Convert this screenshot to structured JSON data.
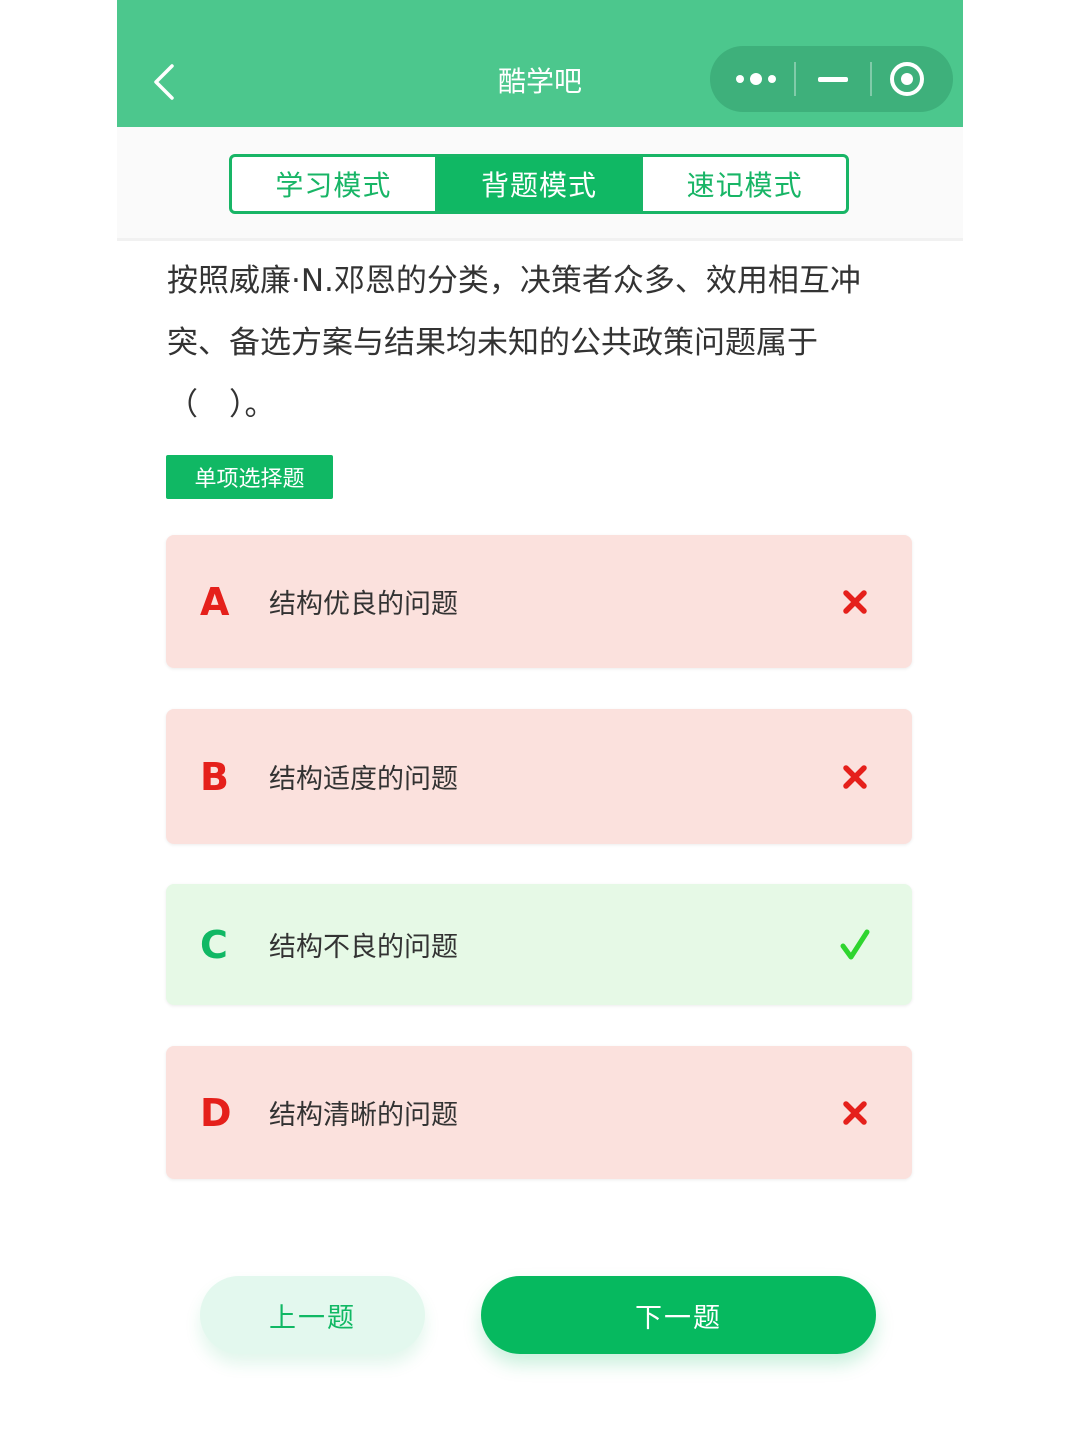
{
  "nav": {
    "title": "酷学吧",
    "icons": [
      "chevron-left-icon",
      "more-dots-icon",
      "minimize-icon",
      "target-icon"
    ]
  },
  "tabs": [
    {
      "label": "学习模式",
      "active": false
    },
    {
      "label": "背题模式",
      "active": true
    },
    {
      "label": "速记模式",
      "active": false
    }
  ],
  "question": {
    "text": "按照威廉·N.邓恩的分类，决策者众多、效用相互冲突、备选方案与结果均未知的公共政策问题属于（　）。",
    "type_label": "单项选择题"
  },
  "options": [
    {
      "letter": "A",
      "text": "结构优良的问题",
      "status": "wrong"
    },
    {
      "letter": "B",
      "text": "结构适度的问题",
      "status": "wrong"
    },
    {
      "letter": "C",
      "text": "结构不良的问题",
      "status": "correct"
    },
    {
      "letter": "D",
      "text": "结构清晰的问题",
      "status": "wrong"
    }
  ],
  "buttons": {
    "prev": "上一题",
    "next": "下一题"
  },
  "colors": {
    "nav": "#4cc78d",
    "accent": "#10b864",
    "wrong_bg": "#fbe1dd",
    "wrong": "#e5201b",
    "correct_bg": "#e6f9e6",
    "correct_mark": "#2fd52f"
  }
}
